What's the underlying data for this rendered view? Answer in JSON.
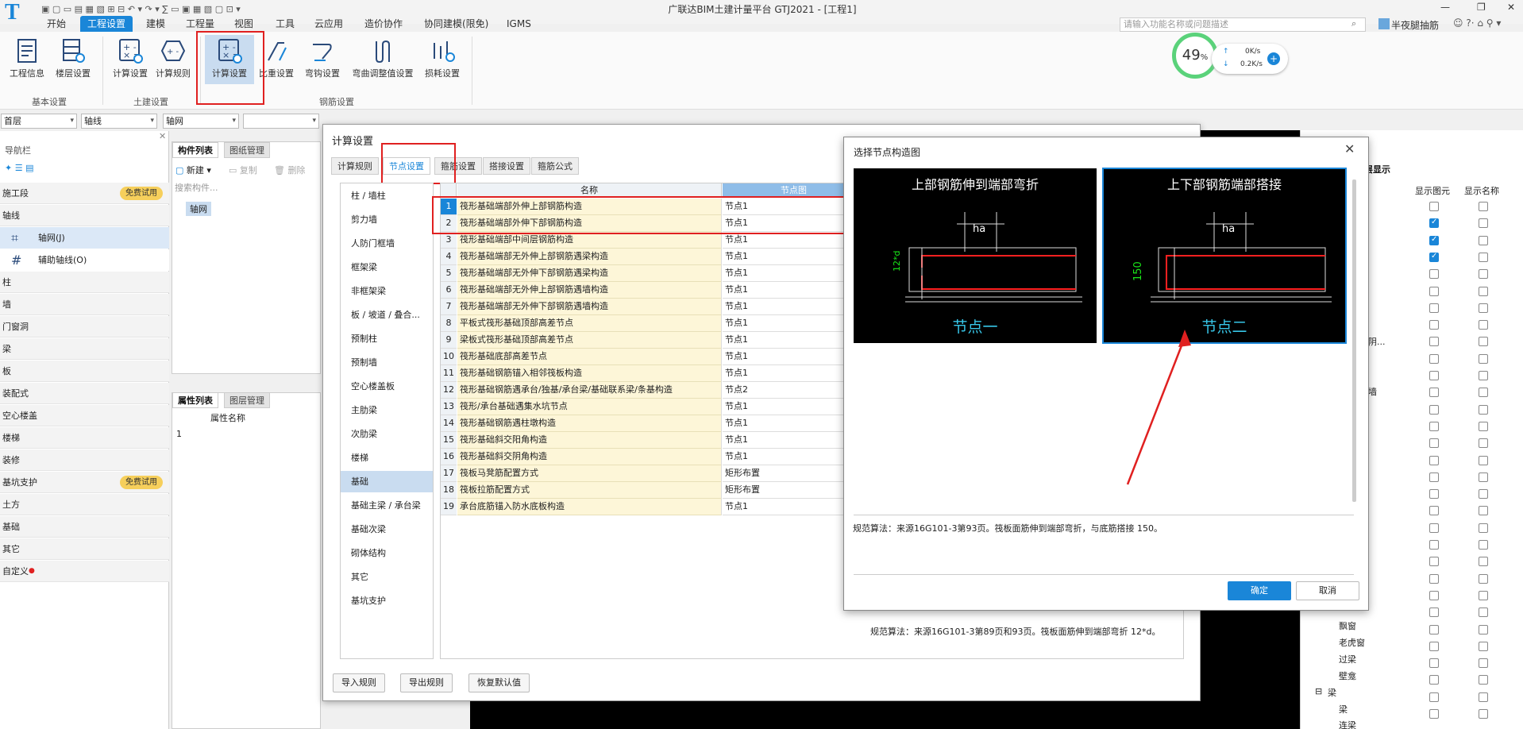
{
  "window": {
    "title": "广联达BIM土建计量平台 GTJ2021 - [工程1]",
    "minimize": "—",
    "restore": "❐",
    "close": "✕"
  },
  "menubar": {
    "items": [
      "开始",
      "工程设置",
      "建模",
      "工程量",
      "视图",
      "工具",
      "云应用",
      "造价协作",
      "协同建模(限免)",
      "IGMS"
    ],
    "active": "工程设置"
  },
  "search": {
    "placeholder": "请输入功能名称或问题描述"
  },
  "user": {
    "name": "半夜腿抽筋"
  },
  "ribbon": {
    "buttons": [
      "工程信息",
      "楼层设置",
      "计算设置",
      "计算规则",
      "计算设置",
      "比重设置",
      "弯钩设置",
      "弯曲调整值设置",
      "损耗设置"
    ],
    "groups": [
      "基本设置",
      "土建设置",
      "钢筋设置"
    ]
  },
  "monitor": {
    "percent": "49",
    "unit": "%",
    "up": "0K/s",
    "down": "0.2K/s"
  },
  "filters": {
    "floor": "首层",
    "type": "轴线",
    "component": "轴网",
    "extra": ""
  },
  "nav": {
    "title": "导航栏",
    "badge": "免费试用",
    "items": [
      "施工段",
      "轴线",
      "轴网(J)",
      "辅助轴线(O)",
      "柱",
      "墙",
      "门窗洞",
      "梁",
      "板",
      "装配式",
      "空心楼盖",
      "楼梯",
      "装修",
      "基坑支护",
      "土方",
      "基础",
      "其它",
      "自定义"
    ]
  },
  "comp_panel": {
    "tabs": [
      "构件列表",
      "图纸管理"
    ],
    "new": "新建",
    "copy": "复制",
    "delete": "删除",
    "search": "搜索构件...",
    "item": "轴网"
  },
  "attr_panel": {
    "tabs": [
      "属性列表",
      "图层管理"
    ],
    "col": "属性名称",
    "row1": "1"
  },
  "right_panel": {
    "tab": "层显示",
    "cols": [
      "件",
      "显示图元",
      "显示名称"
    ],
    "labels": [
      "线",
      "非阴...",
      "框墙",
      "筋",
      "飘窗",
      "老虎窗",
      "过梁",
      "壁龛",
      "梁",
      "连梁"
    ]
  },
  "calc_dialog": {
    "title": "计算设置",
    "tabs": [
      "计算规则",
      "节点设置",
      "箍筋设置",
      "搭接设置",
      "箍筋公式"
    ],
    "categories": [
      "柱 / 墙柱",
      "剪力墙",
      "人防门框墙",
      "框架梁",
      "非框架梁",
      "板 / 坡道 / 叠合...",
      "预制柱",
      "预制墙",
      "空心楼盖板",
      "主肋梁",
      "次肋梁",
      "楼梯",
      "基础",
      "基础主梁 / 承台梁",
      "基础次梁",
      "砌体结构",
      "其它",
      "基坑支护"
    ],
    "selected_category": "基础",
    "headers": {
      "name": "名称",
      "node": "节点图"
    },
    "rows": [
      {
        "no": "1",
        "name": "筏形基础端部外伸上部钢筋构造",
        "node": "节点1"
      },
      {
        "no": "2",
        "name": "筏形基础端部外伸下部钢筋构造",
        "node": "节点1"
      },
      {
        "no": "3",
        "name": "筏形基础端部中间层钢筋构造",
        "node": "节点1"
      },
      {
        "no": "4",
        "name": "筏形基础端部无外伸上部钢筋遇梁构造",
        "node": "节点1"
      },
      {
        "no": "5",
        "name": "筏形基础端部无外伸下部钢筋遇梁构造",
        "node": "节点1"
      },
      {
        "no": "6",
        "name": "筏形基础端部无外伸上部钢筋遇墙构造",
        "node": "节点1"
      },
      {
        "no": "7",
        "name": "筏形基础端部无外伸下部钢筋遇墙构造",
        "node": "节点1"
      },
      {
        "no": "8",
        "name": "平板式筏形基础顶部高差节点",
        "node": "节点1"
      },
      {
        "no": "9",
        "name": "梁板式筏形基础顶部高差节点",
        "node": "节点1"
      },
      {
        "no": "10",
        "name": "筏形基础底部高差节点",
        "node": "节点1"
      },
      {
        "no": "11",
        "name": "筏形基础钢筋锚入相邻筏板构造",
        "node": "节点1"
      },
      {
        "no": "12",
        "name": "筏形基础钢筋遇承台/独基/承台梁/基础联系梁/条基构造",
        "node": "节点2"
      },
      {
        "no": "13",
        "name": "筏形/承台基础遇集水坑节点",
        "node": "节点1"
      },
      {
        "no": "14",
        "name": "筏形基础钢筋遇柱墩构造",
        "node": "节点1"
      },
      {
        "no": "15",
        "name": "筏形基础斜交阳角构造",
        "node": "节点1"
      },
      {
        "no": "16",
        "name": "筏形基础斜交阴角构造",
        "node": "节点1"
      },
      {
        "no": "17",
        "name": "筏板马凳筋配置方式",
        "node": "矩形布置"
      },
      {
        "no": "18",
        "name": "筏板拉筋配置方式",
        "node": "矩形布置"
      },
      {
        "no": "19",
        "name": "承台底筋锚入防水底板构造",
        "node": "节点1"
      }
    ],
    "note": "规范算法：来源16G101-3第89页和93页。筏板面筋伸到端部弯折 12*d。",
    "buttons": [
      "导入规则",
      "导出规则",
      "恢复默认值"
    ]
  },
  "node_dialog": {
    "title": "选择节点构造图",
    "options": [
      {
        "title": "上部钢筋伸到端部弯折",
        "caption": "节点一",
        "dim_side": "12*d",
        "dim_top": "ha"
      },
      {
        "title": "上下部钢筋端部搭接",
        "caption": "节点二",
        "dim_side": "150",
        "dim_top": "ha"
      }
    ],
    "rule": "规范算法：来源16G101-3第93页。筏板面筋伸到端部弯折，与底筋搭接 150。",
    "ok": "确定",
    "cancel": "取消"
  },
  "colors": {
    "accent": "#1a86d8",
    "highlight": "#e02020",
    "rebar": "#ff2020",
    "caption": "#37c6e8",
    "gauge": "#5ad27a"
  }
}
